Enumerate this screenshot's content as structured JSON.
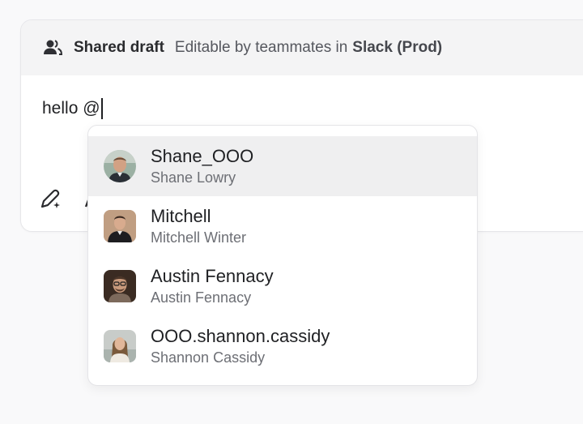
{
  "header": {
    "icon": "people-icon",
    "title": "Shared draft",
    "description": "Editable by teammates in",
    "workspace": "Slack (Prod)"
  },
  "editor": {
    "text": "hello @"
  },
  "toolbar": {
    "icons": [
      "pen-sparkle-icon"
    ]
  },
  "mentions": {
    "items": [
      {
        "handle": "Shane_OOO",
        "name": "Shane Lowry",
        "selected": true
      },
      {
        "handle": "Mitchell",
        "name": "Mitchell Winter",
        "selected": false
      },
      {
        "handle": "Austin Fennacy",
        "name": "Austin Fennacy",
        "selected": false
      },
      {
        "handle": "OOO.shannon.cassidy",
        "name": "Shannon Cassidy",
        "selected": false
      }
    ]
  },
  "colors": {
    "selected_row": "#efeff0",
    "header_bg": "#f4f4f5",
    "muted_text": "#6d6f75"
  }
}
